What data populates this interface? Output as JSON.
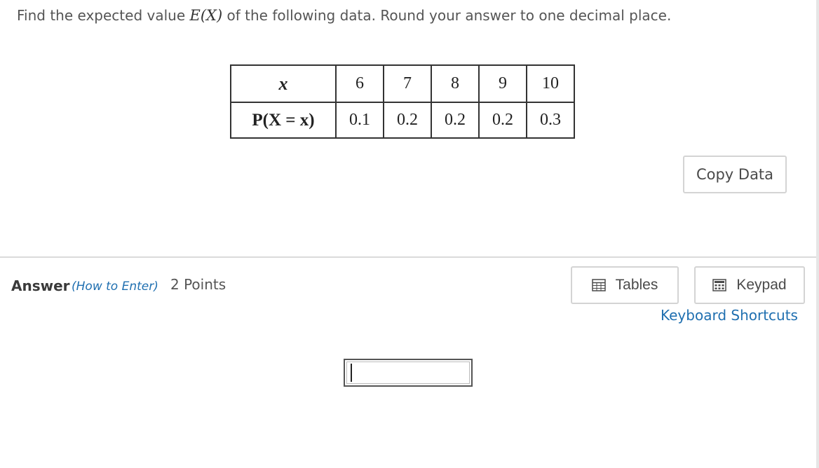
{
  "question": {
    "before": "Find the expected value ",
    "math": "E(X)",
    "after": " of the following data. Round your answer to one decimal place."
  },
  "table": {
    "row1_header": "x",
    "row2_header": "P(X = x)",
    "x_values": [
      "6",
      "7",
      "8",
      "9",
      "10"
    ],
    "p_values": [
      "0.1",
      "0.2",
      "0.2",
      "0.2",
      "0.3"
    ]
  },
  "copy_data": {
    "label": "Copy Data"
  },
  "answer": {
    "label": "Answer",
    "how_to": "(How to Enter)",
    "points": "2 Points",
    "input_value": ""
  },
  "tools": {
    "tables_label": "Tables",
    "keypad_label": "Keypad",
    "shortcuts_label": "Keyboard Shortcuts"
  },
  "icons": {
    "tables": "table-grid-icon",
    "keypad": "keypad-icon"
  },
  "colors": {
    "link": "#1f6fb0",
    "border": "#d4d4d4",
    "text": "#555555"
  }
}
